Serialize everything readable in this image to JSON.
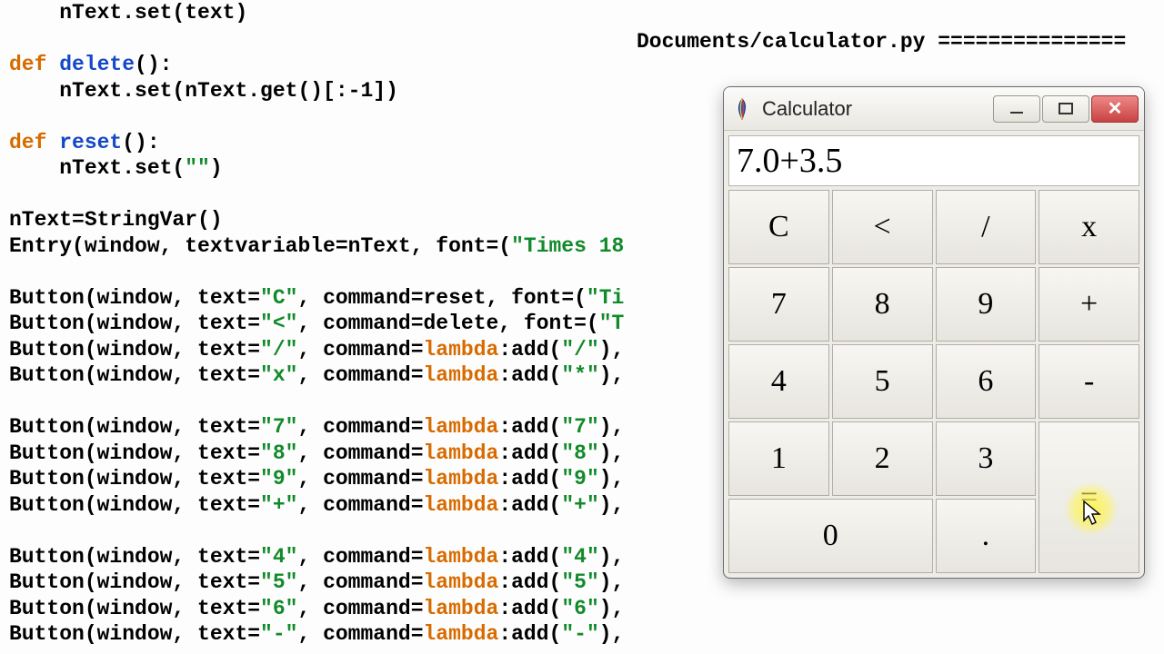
{
  "right_header": "Documents/calculator.py ===============",
  "calculator": {
    "title": "Calculator",
    "display": "7.0+3.5",
    "buttons": {
      "C": "C",
      "lt": "<",
      "div": "/",
      "mul": "x",
      "7": "7",
      "8": "8",
      "9": "9",
      "plus": "+",
      "4": "4",
      "5": "5",
      "6": "6",
      "minus": "-",
      "1": "1",
      "2": "2",
      "3": "3",
      "0": "0",
      "dot": ".",
      "eq": "="
    }
  },
  "code": {
    "l01a": "    nText.set(text)",
    "l02": "",
    "l03_def": "def ",
    "l03_fn": "delete",
    "l03_rest": "():",
    "l04": "    nText.set(nText.get()[:-1])",
    "l05": "",
    "l06_def": "def ",
    "l06_fn": "reset",
    "l06_rest": "():",
    "l07a": "    nText.set(",
    "l07s": "\"\"",
    "l07b": ")",
    "l08": "",
    "l09": "nText=StringVar()",
    "l10a": "Entry(window, textvariable=nText, font=(",
    "l10s": "\"Times 18",
    "l11": "",
    "l12a": "Button(window, text=",
    "l12s": "\"C\"",
    "l12b": ", command=reset, font=(",
    "l12s2": "\"Ti",
    "l13a": "Button(window, text=",
    "l13s": "\"<\"",
    "l13b": ", command=delete, font=(",
    "l13s2": "\"T",
    "l14a": "Button(window, text=",
    "l14s": "\"/\"",
    "l14b": ", command=",
    "l14lam": "lambda",
    "l14c": ":add(",
    "l14s2": "\"/\"",
    "l14d": "),",
    "l15a": "Button(window, text=",
    "l15s": "\"x\"",
    "l15b": ", command=",
    "l15lam": "lambda",
    "l15c": ":add(",
    "l15s2": "\"*\"",
    "l15d": "),",
    "l16": "",
    "l17a": "Button(window, text=",
    "l17s": "\"7\"",
    "l17b": ", command=",
    "l17lam": "lambda",
    "l17c": ":add(",
    "l17s2": "\"7\"",
    "l17d": "),",
    "l18a": "Button(window, text=",
    "l18s": "\"8\"",
    "l18b": ", command=",
    "l18lam": "lambda",
    "l18c": ":add(",
    "l18s2": "\"8\"",
    "l18d": "),",
    "l19a": "Button(window, text=",
    "l19s": "\"9\"",
    "l19b": ", command=",
    "l19lam": "lambda",
    "l19c": ":add(",
    "l19s2": "\"9\"",
    "l19d": "),",
    "l20a": "Button(window, text=",
    "l20s": "\"+\"",
    "l20b": ", command=",
    "l20lam": "lambda",
    "l20c": ":add(",
    "l20s2": "\"+\"",
    "l20d": "),",
    "l21": "",
    "l22a": "Button(window, text=",
    "l22s": "\"4\"",
    "l22b": ", command=",
    "l22lam": "lambda",
    "l22c": ":add(",
    "l22s2": "\"4\"",
    "l22d": "),",
    "l23a": "Button(window, text=",
    "l23s": "\"5\"",
    "l23b": ", command=",
    "l23lam": "lambda",
    "l23c": ":add(",
    "l23s2": "\"5\"",
    "l23d": "),",
    "l24a": "Button(window, text=",
    "l24s": "\"6\"",
    "l24b": ", command=",
    "l24lam": "lambda",
    "l24c": ":add(",
    "l24s2": "\"6\"",
    "l24d": "),",
    "l25a": "Button(window, text=",
    "l25s": "\"-\"",
    "l25b": ", command=",
    "l25lam": "lambda",
    "l25c": ":add(",
    "l25s2": "\"-\"",
    "l25d": "),"
  }
}
